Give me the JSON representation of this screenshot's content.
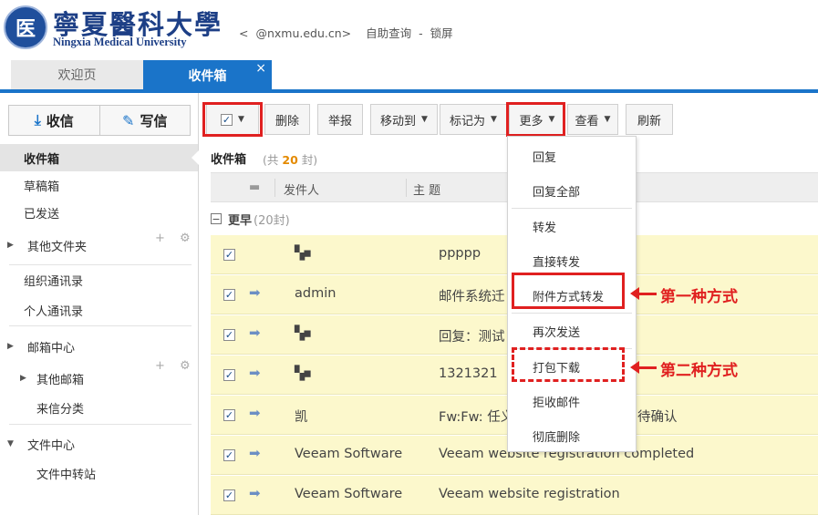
{
  "header": {
    "logo_seal_glyph": "医",
    "logo_cn": "寧夏醫科大學",
    "logo_en": "Ningxia Medical University",
    "user_prefix": "<",
    "user_domain": "@nxmu.edu.cn>",
    "link_self_query": "自助查询",
    "separator": "-",
    "link_lock": "锁屏"
  },
  "tabs": {
    "welcome": "欢迎页",
    "inbox": "收件箱",
    "close": "×"
  },
  "sidebar": {
    "receive_label": "收信",
    "write_label": "写信",
    "items": {
      "inbox": "收件箱",
      "drafts": "草稿箱",
      "sent": "已发送",
      "other_folders": "其他文件夹",
      "org_contacts": "组织通讯录",
      "personal_contacts": "个人通讯录",
      "mailbox_center": "邮箱中心",
      "other_mailboxes": "其他邮箱",
      "mail_sort": "来信分类",
      "file_center": "文件中心",
      "file_transfer": "文件中转站"
    },
    "folder_actions": "+ ⚙"
  },
  "toolbar": {
    "check_mark": "✓",
    "delete": "删除",
    "report": "举报",
    "move_to": "移动到",
    "mark_as": "标记为",
    "more": "更多",
    "view": "查看",
    "refresh": "刷新"
  },
  "list": {
    "title": "收件箱",
    "count_prefix": "(共",
    "count_value": "20",
    "count_suffix": "封)",
    "col_sender": "发件人",
    "col_subject": "主  题",
    "group_label": "更早",
    "group_count": "(20封)",
    "rows": [
      {
        "sender": "▚▪",
        "subject": "ppppp",
        "extra": "",
        "has_arrow": false
      },
      {
        "sender": "admin",
        "subject": "邮件系统迁",
        "extra": "",
        "has_arrow": true
      },
      {
        "sender": "▚▪",
        "subject": "回复：测试",
        "extra": "",
        "has_arrow": true
      },
      {
        "sender": "▚▪",
        "subject": "1321321",
        "extra": "",
        "has_arrow": true
      },
      {
        "sender": "凯",
        "subject": "Fw:Fw: 任义",
        "extra": "待确认",
        "has_arrow": true
      },
      {
        "sender": "Veeam Software",
        "subject": "Veeam website registration completed",
        "extra": "",
        "has_arrow": true
      },
      {
        "sender": "Veeam Software",
        "subject": "Veeam website registration",
        "extra": "",
        "has_arrow": true
      }
    ]
  },
  "dropdown": {
    "reply": "回复",
    "reply_all": "回复全部",
    "forward": "转发",
    "direct_forward": "直接转发",
    "forward_as_attachment": "附件方式转发",
    "resend": "再次发送",
    "pack_download": "打包下载",
    "reject": "拒收邮件",
    "purge": "彻底删除"
  },
  "annotations": {
    "method_one": "第一种方式",
    "method_two": "第二种方式"
  },
  "colors": {
    "accent_blue": "#1a74c9",
    "annotation_red": "#e02020",
    "row_highlight": "#fcf8cc"
  }
}
